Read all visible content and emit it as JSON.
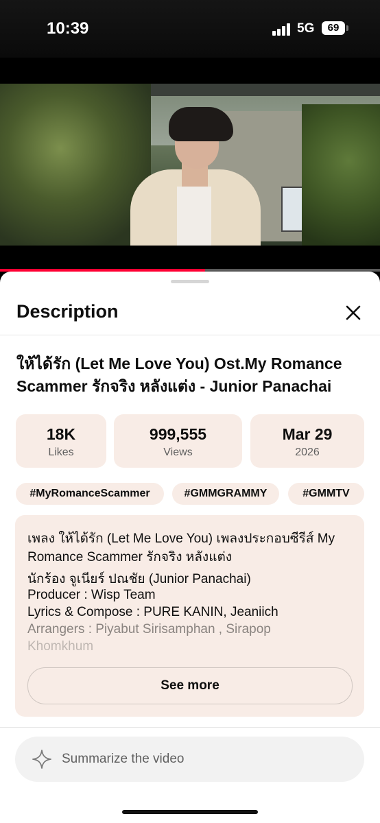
{
  "status_bar": {
    "time": "10:39",
    "network": "5G",
    "battery": "69"
  },
  "player": {
    "progress_fraction": 0.54
  },
  "sheet": {
    "title": "Description",
    "video_title": "ให้ได้รัก (Let Me Love You) Ost.My Romance Scammer รักจริง หลังแต่ง - Junior Panachai",
    "stats": [
      {
        "value": "18K",
        "label": "Likes"
      },
      {
        "value": "999,555",
        "label": "Views"
      },
      {
        "value": "Mar 29",
        "label": "2026"
      }
    ],
    "hashtags": [
      "#MyRomanceScammer",
      "#GMMGRAMMY",
      "#GMMTV"
    ],
    "description_lines": [
      "เพลง ให้ได้รัก (Let Me Love You) เพลงประกอบซีรีส์ My",
      "Romance Scammer รักจริง หลังแต่ง",
      "นักร้อง จูเนียร์ ปณชัย (Junior Panachai)",
      "Producer : Wisp Team",
      "Lyrics & Compose : PURE KANIN, Jeaniich",
      "Arrangers : Piyabut Sirisamphan , Sirapop",
      "Khomkhum"
    ],
    "see_more_label": "See more",
    "summarize_label": "Summarize the video"
  },
  "icons": {
    "close": "close-icon",
    "sparkle": "sparkle-icon"
  }
}
